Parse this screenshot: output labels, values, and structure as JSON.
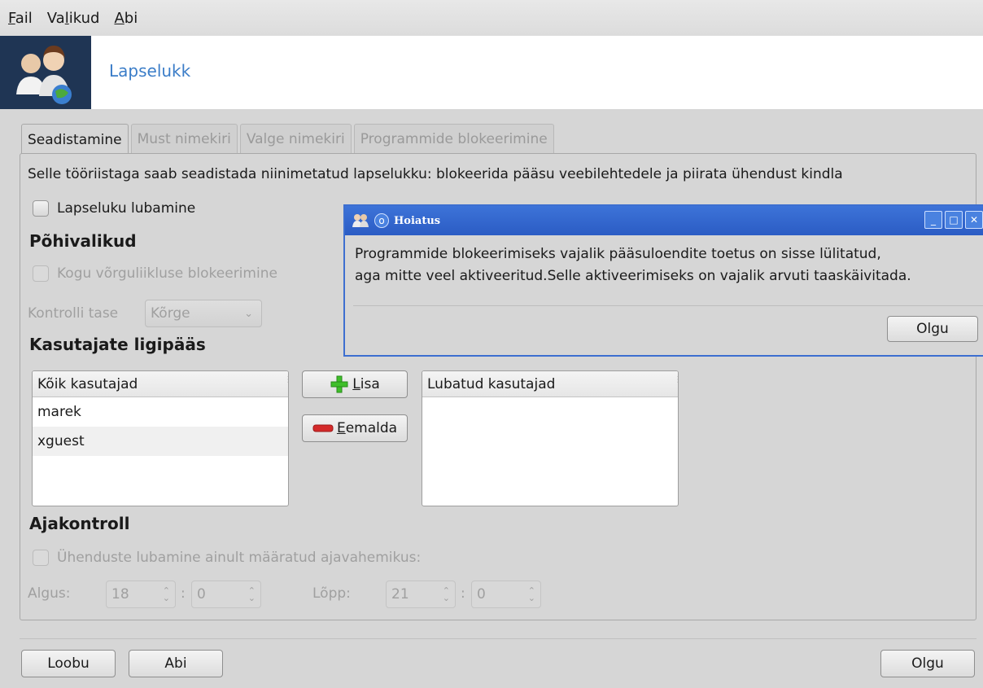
{
  "menubar": {
    "items": [
      {
        "pre": "",
        "acc": "F",
        "post": "ail"
      },
      {
        "pre": "Va",
        "acc": "l",
        "post": "ikud"
      },
      {
        "pre": "",
        "acc": "A",
        "post": "bi"
      }
    ]
  },
  "banner": {
    "title": "Lapselukk"
  },
  "tabs": [
    "Seadistamine",
    "Must nimekiri",
    "Valge nimekiri",
    "Programmide blokeerimine"
  ],
  "main": {
    "description": "Selle tööriistaga saab seadistada niinimetatud lapselukku: blokeerida pääsu veebilehtedele ja piirata ühendust kindla",
    "enable_label": "Lapseluku lubamine",
    "basic_heading": "Põhivalikud",
    "block_all_label": "Kogu võrguliikluse blokeerimine",
    "control_level_label": "Kontrolli tase",
    "control_level_value": "Kõrge",
    "access_heading": "Kasutajate ligipääs",
    "all_users_header": "Kõik kasutajad",
    "all_users": [
      "marek",
      "xguest"
    ],
    "allowed_users_header": "Lubatud kasutajad",
    "add_prefix": "",
    "add_acc": "L",
    "add_suffix": "isa",
    "remove_acc": "E",
    "remove_suffix": "emalda",
    "time_heading": "Ajakontroll",
    "time_restrict_label": "Ühenduste lubamine ainult määratud ajavahemikus:",
    "start_label": "Algus:",
    "start_hour": "18",
    "start_min": "0",
    "end_label": "Lõpp:",
    "end_hour": "21",
    "end_min": "0",
    "colon": ":"
  },
  "footer": {
    "cancel": "Loobu",
    "help": "Abi",
    "ok": "Olgu"
  },
  "dialog": {
    "title": "Hoiatus",
    "line1": "Programmide blokeerimiseks vajalik pääsuloendite toetus on sisse lülitatud,",
    "line2": "aga mitte veel aktiveeritud.Selle aktiveerimiseks on vajalik arvuti taaskäivitada.",
    "ok": "Olgu"
  },
  "colors": {
    "accent": "#3b7dc8",
    "dialog_title": "#2b5cc4",
    "add_icon": "#3fbf2a",
    "remove_icon": "#d42a2a"
  }
}
